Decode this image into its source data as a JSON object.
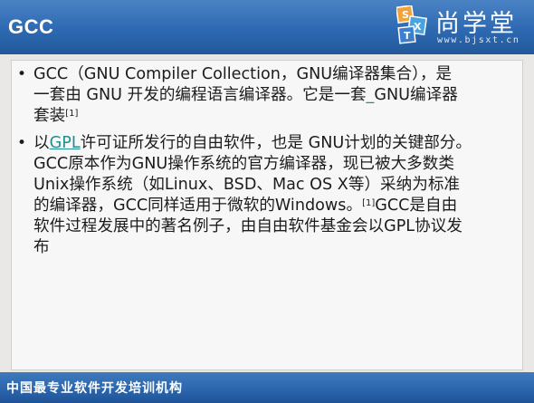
{
  "header": {
    "title": "GCC",
    "logo": {
      "brand_cn": "尚学堂",
      "url": "www.bjsxt.cn",
      "mark_letters": [
        "S",
        "X",
        "T"
      ]
    }
  },
  "bullets": [
    {
      "lines": [
        "GCC（GNU Compiler Collection，GNU编译器集合），是",
        "一套由 GNU 开发的编程语言编译器。它是一套",
        "套装"
      ],
      "line2_tail": "GNU编译器",
      "line2_mark": "_",
      "line3_sup": "[1]"
    },
    {
      "line1_prefix": "以",
      "line1_link": "GPL",
      "line1_suffix": "许可证所发行的自由软件，也是 GNU计划的关键部分。",
      "lines": [
        "GCC原本作为GNU操作系统的官方编译器，现已被大多数类",
        "Unix操作系统（如Linux、BSD、Mac OS X等）采纳为标准",
        "的编译器，GCC同样适用于微软的Windows。",
        "软件过程发展中的著名例子，由自由软件基金会以GPL协议发",
        "布"
      ],
      "line4_sup": "[1]",
      "line4_tail": "GCC是自由"
    }
  ],
  "footer": {
    "text": "中国最专业软件开发培训机构"
  },
  "colors": {
    "header_blue": "#2d69b2",
    "link_teal": "#1f8f8f",
    "content_bg": "#f7f7f7"
  }
}
